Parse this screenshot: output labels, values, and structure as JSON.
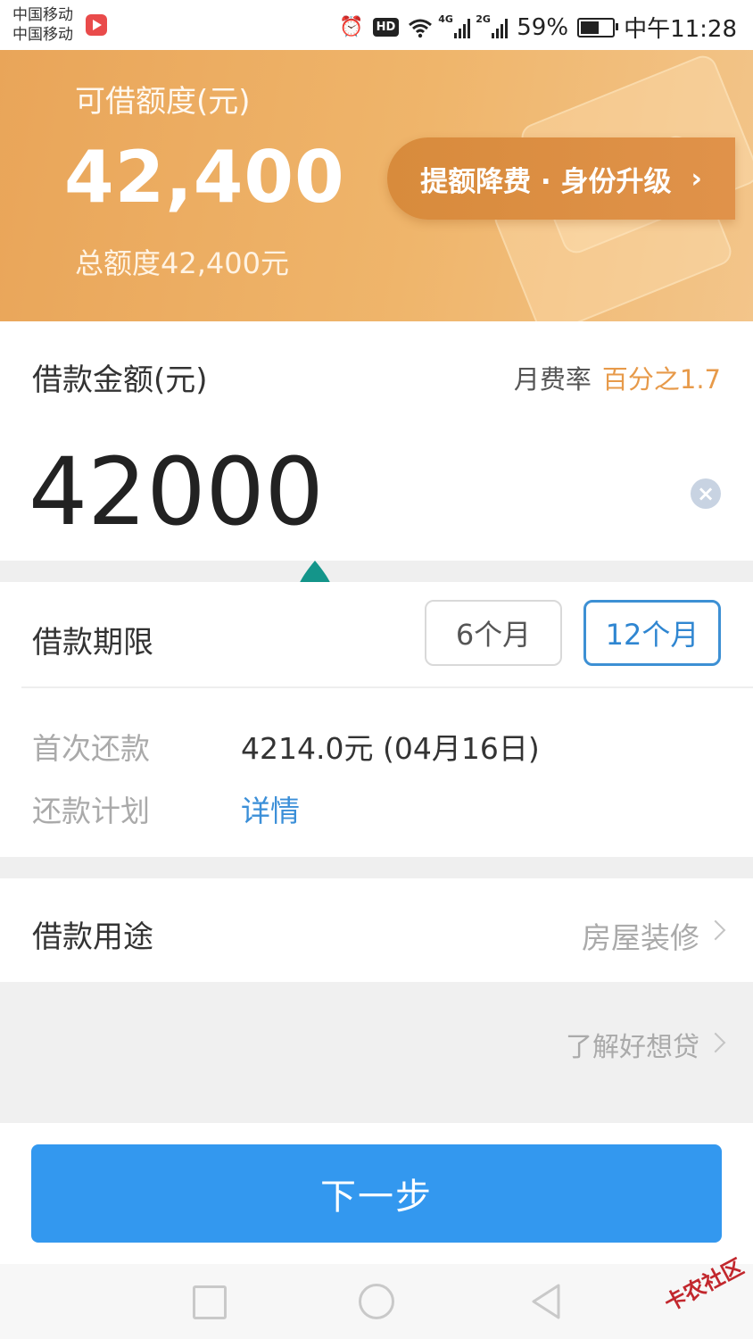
{
  "status_bar": {
    "carrier_1": "中国移动",
    "carrier_2": "中国移动",
    "net_1": "4G",
    "net_2": "2G",
    "battery": "59%",
    "time": "中午11:28"
  },
  "hero": {
    "label": "可借额度(元)",
    "amount": "42,400",
    "total": "总额度42,400元",
    "upgrade_label": "提额降费 · 身份升级"
  },
  "amount_section": {
    "title": "借款金额(元)",
    "rate_label": "月费率",
    "rate_value": "百分之1.7",
    "input_value": "42000"
  },
  "term_section": {
    "title": "借款期限",
    "options": [
      "6个月",
      "12个月"
    ],
    "selected": "12个月"
  },
  "repayment": {
    "first_label": "首次还款",
    "first_value": "4214.0元 (04月16日)",
    "plan_label": "还款计划",
    "plan_link": "详情"
  },
  "purpose": {
    "label": "借款用途",
    "value": "房屋装修"
  },
  "info_link": "了解好想贷",
  "next_button": "下一步",
  "watermark": "卡农社区",
  "colors": {
    "hero_orange": "#efb56b",
    "upgrade_button": "#dc8f43",
    "rate_orange": "#e79a4a",
    "selected_blue": "#3d90d4",
    "primary_blue": "#3398ef",
    "marker_teal": "#14958a"
  }
}
